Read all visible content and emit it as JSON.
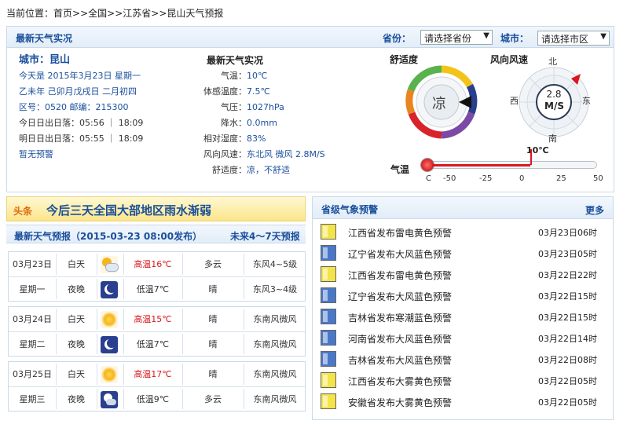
{
  "breadcrumb": {
    "prefix": "当前位置：",
    "home": "首页",
    "sep1": ">>",
    "country": "全国",
    "sep2": ">>",
    "province": "江苏省",
    "sep3": ">>",
    "current": "昆山天气预报"
  },
  "live": {
    "title": "最新天气实况",
    "province_label": "省份：",
    "province_value": "请选择省份",
    "city_label": "城市：",
    "city_value": "请选择市区",
    "city_name": "城市：昆山",
    "today": "今天是 2015年3月23日 星期一",
    "lunar": "乙未年 己卯月戊戌日 二月初四",
    "postal": "区号：0520  邮编：215300",
    "sun_today": "今日日出日落：05:56 ｜ 18:09",
    "sun_tomorrow": "明日日出日落：05:55 ｜ 18:09",
    "alert": "暂无预警",
    "obs_title": "最新天气实况",
    "obs": [
      {
        "label": "气温：",
        "value": "10℃"
      },
      {
        "label": "体感温度：",
        "value": "7.5℃"
      },
      {
        "label": "气压：",
        "value": "1027hPa"
      },
      {
        "label": "降水：",
        "value": "0.0mm"
      },
      {
        "label": "相对湿度：",
        "value": "83%"
      },
      {
        "label": "风向风速：",
        "value": "东北风 微风 2.8M/S"
      },
      {
        "label": "舒适度：",
        "value": "凉，不舒适"
      }
    ],
    "comfort_title": "舒适度",
    "comfort_value": "凉",
    "wind_title": "风向风速",
    "wind_speed": "2.8",
    "wind_unit": "M/S",
    "compass": {
      "n": "北",
      "s": "南",
      "e": "东",
      "w": "西"
    },
    "thermo_label": "气温",
    "thermo_value_label": "10℃",
    "thermo_value": 10,
    "thermo_min": -50,
    "thermo_max": 50,
    "thermo_ticks": [
      "C",
      "-50",
      "-25",
      "0",
      "25",
      "50"
    ]
  },
  "headline": {
    "tag": "头条",
    "text": "今后三天全国大部地区雨水渐弱"
  },
  "forecast": {
    "title": "最新天气预报（2015-03-23 08:00发布）",
    "link": "未来4～7天预报",
    "days": [
      {
        "date": "03月23日",
        "weekday": "星期一",
        "day": {
          "period": "白天",
          "icon": "cloud-sun-icon",
          "temp": "高温16℃",
          "weather": "多云",
          "wind": "东风4~5级"
        },
        "night": {
          "period": "夜晚",
          "icon": "moon-icon",
          "temp": "低温7℃",
          "weather": "晴",
          "wind": "东风3~4级"
        }
      },
      {
        "date": "03月24日",
        "weekday": "星期二",
        "day": {
          "period": "白天",
          "icon": "sun-icon",
          "temp": "高温15℃",
          "weather": "晴",
          "wind": "东南风微风"
        },
        "night": {
          "period": "夜晚",
          "icon": "moon-icon",
          "temp": "低温7℃",
          "weather": "晴",
          "wind": "东南风微风"
        }
      },
      {
        "date": "03月25日",
        "weekday": "星期三",
        "day": {
          "period": "白天",
          "icon": "sun-icon",
          "temp": "高温17℃",
          "weather": "晴",
          "wind": "东南风微风"
        },
        "night": {
          "period": "夜晚",
          "icon": "cloud-moon-icon",
          "temp": "低温9℃",
          "weather": "多云",
          "wind": "东南风微风"
        }
      }
    ]
  },
  "warnings": {
    "title": "省级气象预警",
    "more": "更多",
    "items": [
      {
        "icon": "thunder-yellow-icon",
        "color": "#f3e44a",
        "text": "江西省发布雷电黄色预警",
        "time": "03月23日06时"
      },
      {
        "icon": "gale-blue-icon",
        "color": "#4a78c8",
        "text": "辽宁省发布大风蓝色预警",
        "time": "03月23日05时"
      },
      {
        "icon": "thunder-yellow-icon",
        "color": "#f3e44a",
        "text": "江西省发布雷电黄色预警",
        "time": "03月22日22时"
      },
      {
        "icon": "gale-blue-icon",
        "color": "#4a78c8",
        "text": "辽宁省发布大风蓝色预警",
        "time": "03月22日15时"
      },
      {
        "icon": "cold-blue-icon",
        "color": "#4a78c8",
        "text": "吉林省发布寒潮蓝色预警",
        "time": "03月22日15时"
      },
      {
        "icon": "gale-blue-icon",
        "color": "#4a78c8",
        "text": "河南省发布大风蓝色预警",
        "time": "03月22日14时"
      },
      {
        "icon": "gale-blue-icon",
        "color": "#4a78c8",
        "text": "吉林省发布大风蓝色预警",
        "time": "03月22日08时"
      },
      {
        "icon": "fog-yellow-icon",
        "color": "#f3e44a",
        "text": "江西省发布大雾黄色预警",
        "time": "03月22日05时"
      },
      {
        "icon": "fog-yellow-icon",
        "color": "#f3e44a",
        "text": "安徽省发布大雾黄色预警",
        "time": "03月22日05时"
      }
    ]
  }
}
